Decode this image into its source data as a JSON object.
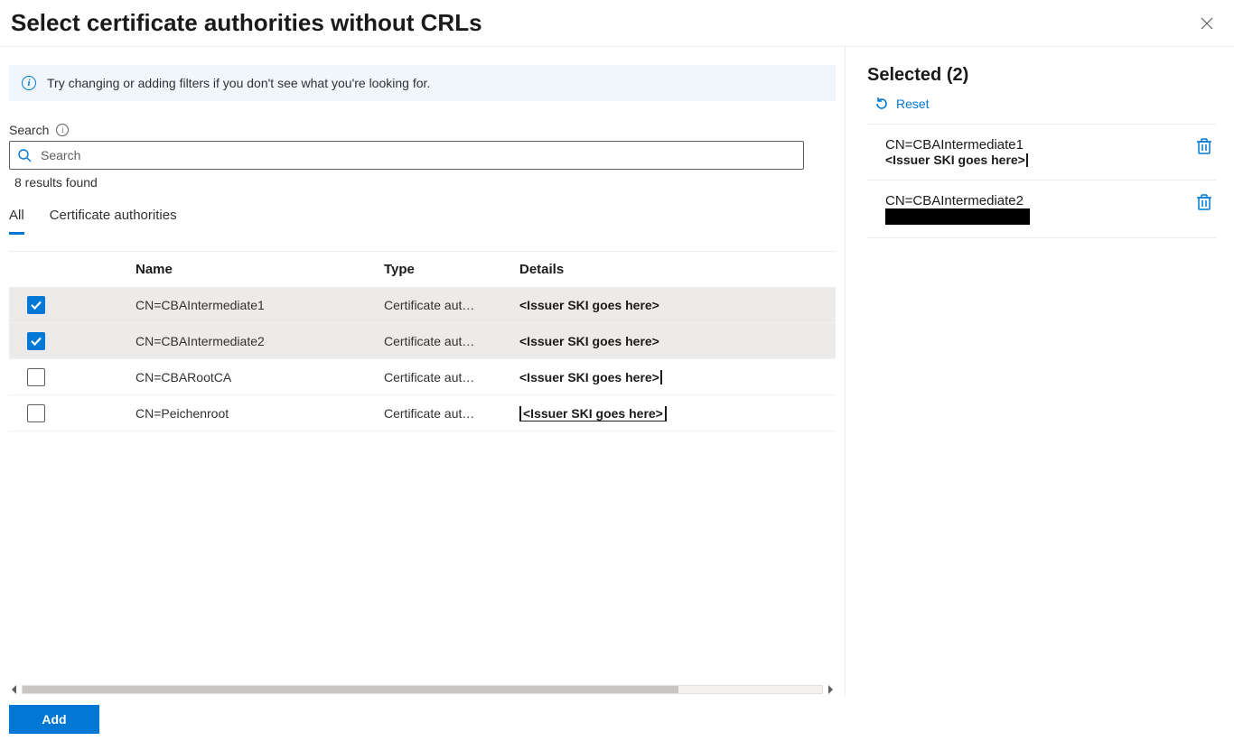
{
  "header": {
    "title": "Select certificate authorities without CRLs"
  },
  "infoBanner": {
    "message": "Try changing or adding filters if you don't see what you're looking for."
  },
  "search": {
    "label": "Search",
    "placeholder": "Search",
    "resultsFound": "8 results found"
  },
  "tabs": {
    "all": "All",
    "cert": "Certificate authorities"
  },
  "table": {
    "columns": {
      "name": "Name",
      "type": "Type",
      "details": "Details"
    },
    "rows": [
      {
        "checked": true,
        "name": "CN=CBAIntermediate1",
        "type": "Certificate aut…",
        "details": "<Issuer SKI goes here>",
        "detailsStyle": "plain"
      },
      {
        "checked": true,
        "name": "CN=CBAIntermediate2",
        "type": "Certificate aut…",
        "details": "<Issuer SKI goes here>",
        "detailsStyle": "plain"
      },
      {
        "checked": false,
        "name": "CN=CBARootCA",
        "type": "Certificate aut…",
        "details": "<Issuer SKI goes here>",
        "detailsStyle": "cursor-after"
      },
      {
        "checked": false,
        "name": "CN=Peichenroot",
        "type": "Certificate aut…",
        "details": "<Issuer SKI goes here>",
        "detailsStyle": "cursor-wrap"
      }
    ]
  },
  "selected": {
    "heading": "Selected (2)",
    "reset": "Reset",
    "items": [
      {
        "line1": "CN=CBAIntermediate1",
        "line2": "<Issuer SKI goes here>",
        "redacted": false
      },
      {
        "line1": "CN=CBAIntermediate2",
        "line2": "redacted",
        "redacted": true
      }
    ]
  },
  "footer": {
    "add": "Add"
  }
}
